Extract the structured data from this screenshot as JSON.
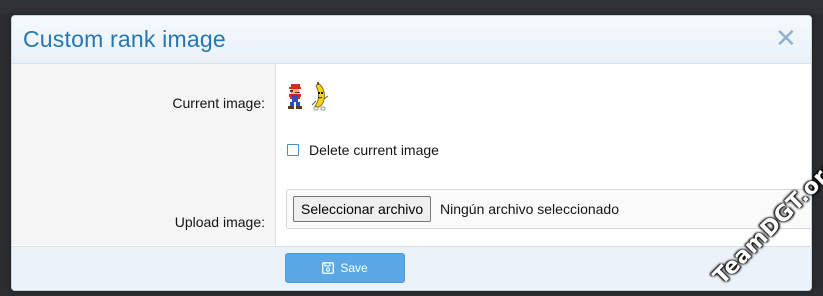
{
  "dialog": {
    "title": "Custom rank image",
    "close_icon": "close-icon"
  },
  "form": {
    "current_image_label": "Current image:",
    "delete_checkbox_label": "Delete current image",
    "delete_checked": false,
    "upload_label": "Upload image:",
    "file_button_label": "Seleccionar archivo",
    "file_status": "Ningún archivo seleccionado"
  },
  "footer": {
    "save_label": "Save",
    "save_icon": "floppy-disk-icon"
  },
  "watermark": {
    "text": "TeamDGT.org"
  },
  "colors": {
    "title": "#2577b1",
    "header_bg": "#e9f1f8",
    "footer_bg": "#ebf2f9",
    "save_button": "#5aa9e6",
    "checkbox_border": "#4b8ec5"
  }
}
